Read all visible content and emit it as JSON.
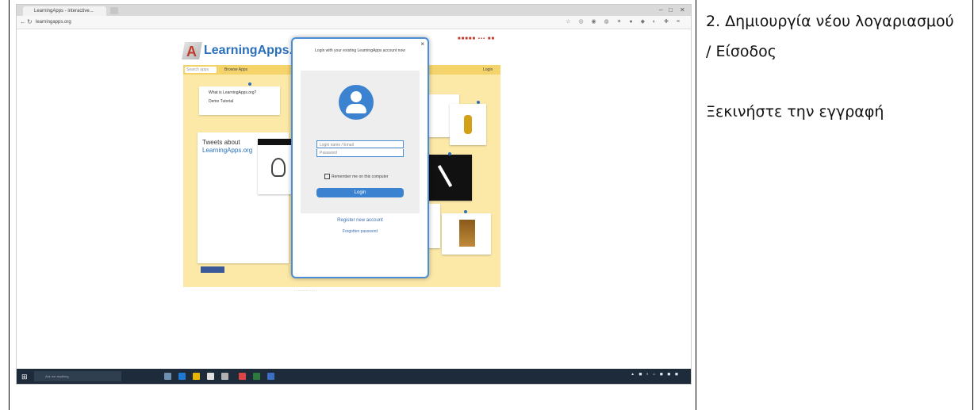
{
  "right_cell": {
    "step_title": "2. Δημιουργία νέου λογαριασμού / Είσοδος",
    "instruction": "Ξεκινήστε την εγγραφή"
  },
  "browser": {
    "tab_title": "LearningApps - interactive...",
    "url": "learningapps.org"
  },
  "site": {
    "logo_text": "LearningApps.org",
    "search_placeholder": "Search apps",
    "nav_browse": "Browse Apps",
    "nav_login": "Login",
    "menu_item_1": "What is LearningApps.org?",
    "menu_item_2": "Demo Tutorial",
    "tweets_title": "Tweets about",
    "tweets_subtitle": "LearningApps.org"
  },
  "login_modal": {
    "title": "Login with your existing LearningApps account now",
    "username_placeholder": "Login name / Email",
    "password_placeholder": "Password",
    "remember_label": "Remember me on this computer",
    "login_button": "Login",
    "register_link": "Register new account",
    "forgot_link": "Forgotten password"
  },
  "taskbar": {
    "search_placeholder": "Ask me anything",
    "accent": "#3b82d0"
  }
}
